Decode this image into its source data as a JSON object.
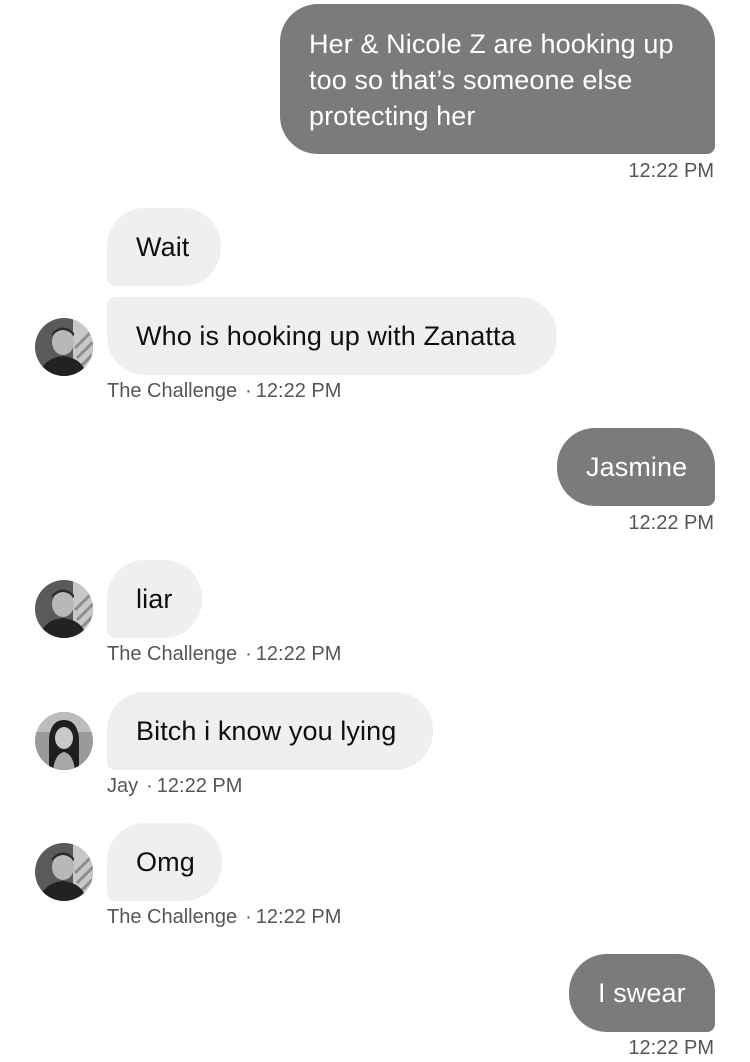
{
  "conversation": {
    "messages": [
      {
        "id": "m1",
        "direction": "sent",
        "lines": [
          "Her & Nicole Z are hooking up",
          "too so that’s someone else",
          "protecting her"
        ],
        "time": "12:22 PM"
      },
      {
        "id": "m2",
        "direction": "received",
        "text": "Wait"
      },
      {
        "id": "m3",
        "direction": "received",
        "text": "Who is hooking up with Zanatta",
        "sender": "The Challenge",
        "time": "12:22 PM",
        "avatar": "challenge-avatar"
      },
      {
        "id": "m4",
        "direction": "sent",
        "text": "Jasmine",
        "time": "12:22 PM"
      },
      {
        "id": "m5",
        "direction": "received",
        "text": "liar",
        "sender": "The Challenge",
        "time": "12:22 PM",
        "avatar": "challenge-avatar"
      },
      {
        "id": "m6",
        "direction": "received",
        "text": "Bitch i know you lying",
        "sender": "Jay",
        "time": "12:22 PM",
        "avatar": "jay-avatar"
      },
      {
        "id": "m7",
        "direction": "received",
        "text": "Omg",
        "sender": "The Challenge",
        "time": "12:22 PM",
        "avatar": "challenge-avatar"
      },
      {
        "id": "m8",
        "direction": "sent",
        "text": "I swear",
        "time": "12:22 PM"
      }
    ],
    "meta_separator": "·"
  },
  "colors": {
    "sent_bubble": "#7b7b7b",
    "received_bubble": "#efefef",
    "meta_text": "#555555",
    "background": "#ffffff"
  }
}
